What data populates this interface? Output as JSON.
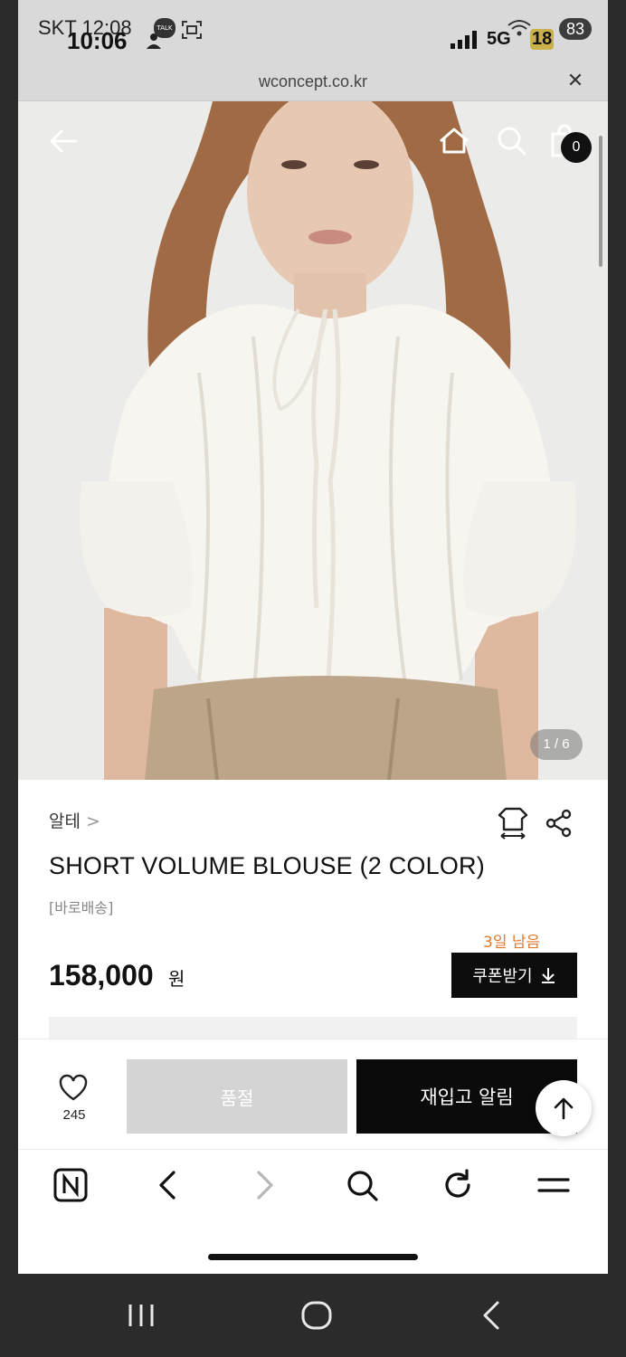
{
  "status_bar": {
    "carrier_time": "SKT 12:08",
    "time_overlay": "10:06",
    "talk_badge": "TALK",
    "network": "5G",
    "notif_count": "18",
    "battery": "83"
  },
  "browser": {
    "url": "wconcept.co.kr",
    "close_icon": "close-icon"
  },
  "hero": {
    "cart_count": "0",
    "image_counter": "1 / 6",
    "icons": [
      "back-arrow-icon",
      "home-icon",
      "search-icon",
      "shopping-bag-icon"
    ]
  },
  "product": {
    "brand": "알테",
    "brand_chevron": ">",
    "title": "SHORT VOLUME BLOUSE (2 COLOR)",
    "tag": "[바로배송]",
    "days_left": "3일 남음",
    "price": "158,000",
    "price_unit": "원",
    "coupon_label": "쿠폰받기",
    "coupon_icon": "download-icon"
  },
  "actions": {
    "like_count": "245",
    "soldout_label": "품절",
    "restock_label": "재입고 알림"
  },
  "colors": {
    "accent_orange": "#e07a2c",
    "black_button": "#0b0b0b",
    "disabled_button": "#d4d4d4"
  }
}
